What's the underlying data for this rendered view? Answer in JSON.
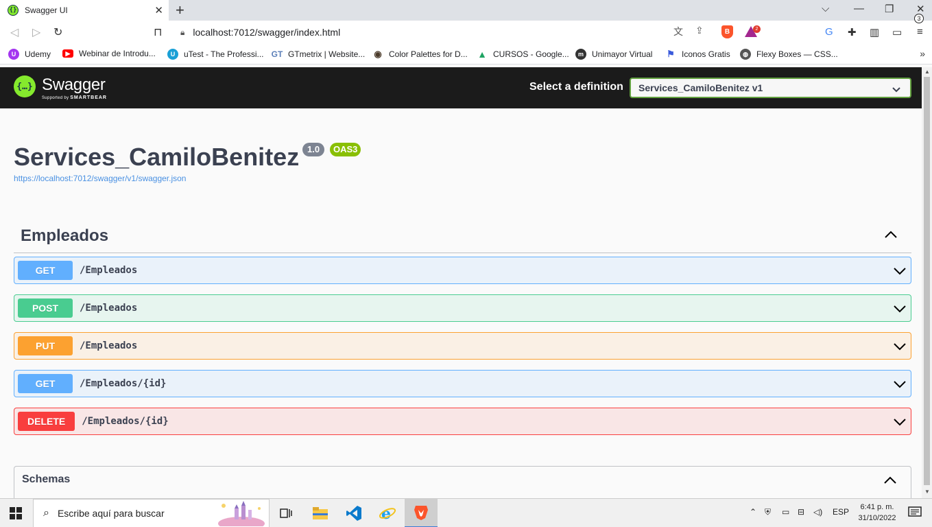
{
  "browser": {
    "tab_title": "Swagger UI",
    "url": "localhost:7012/swagger/index.html",
    "rewards_badge": "2",
    "bookmarks": [
      {
        "label": "Udemy",
        "icon": "udemy-icon",
        "color": "#a435f0"
      },
      {
        "label": "Webinar de Introdu...",
        "icon": "youtube-icon",
        "color": "#ff0000"
      },
      {
        "label": "uTest - The Professi...",
        "icon": "utest-icon",
        "color": "#1aa0d6"
      },
      {
        "label": "GTmetrix | Website...",
        "icon": "gtmetrix-icon",
        "color": "#5b7fb8"
      },
      {
        "label": "Color Palettes for D...",
        "icon": "palette-icon",
        "color": "#4a3a2a"
      },
      {
        "label": "CURSOS - Google...",
        "icon": "google-drive-icon",
        "color": "#1fa463"
      },
      {
        "label": "Unimayor Virtual",
        "icon": "moodle-icon",
        "color": "#333333"
      },
      {
        "label": "Iconos Gratis",
        "icon": "flag-icon",
        "color": "#3b5bdb"
      },
      {
        "label": "Flexy Boxes — CSS...",
        "icon": "globe-icon",
        "color": "#555555"
      }
    ]
  },
  "swagger": {
    "logo_text": "Swagger",
    "logo_sub_prefix": "Supported by",
    "logo_sub_brand": "SMARTBEAR",
    "definition_label": "Select a definition",
    "definition_value": "Services_CamiloBenitez v1",
    "title": "Services_CamiloBenitez",
    "version": "1.0",
    "oas": "OAS3",
    "json_url": "https://localhost:7012/swagger/v1/swagger.json",
    "tag": "Empleados",
    "operations": [
      {
        "method": "GET",
        "path": "/Empleados"
      },
      {
        "method": "POST",
        "path": "/Empleados"
      },
      {
        "method": "PUT",
        "path": "/Empleados"
      },
      {
        "method": "GET",
        "path": "/Empleados/{id}"
      },
      {
        "method": "DELETE",
        "path": "/Empleados/{id}"
      }
    ],
    "schemas_label": "Schemas"
  },
  "colors": {
    "get": "#61affe",
    "post": "#49cc90",
    "put": "#fca130",
    "delete": "#f93e3e",
    "swagger_green": "#85ea2d"
  },
  "taskbar": {
    "search_placeholder": "Escribe aquí para buscar",
    "language": "ESP",
    "time": "6:41 p. m.",
    "date": "31/10/2022",
    "notifications": "3"
  }
}
